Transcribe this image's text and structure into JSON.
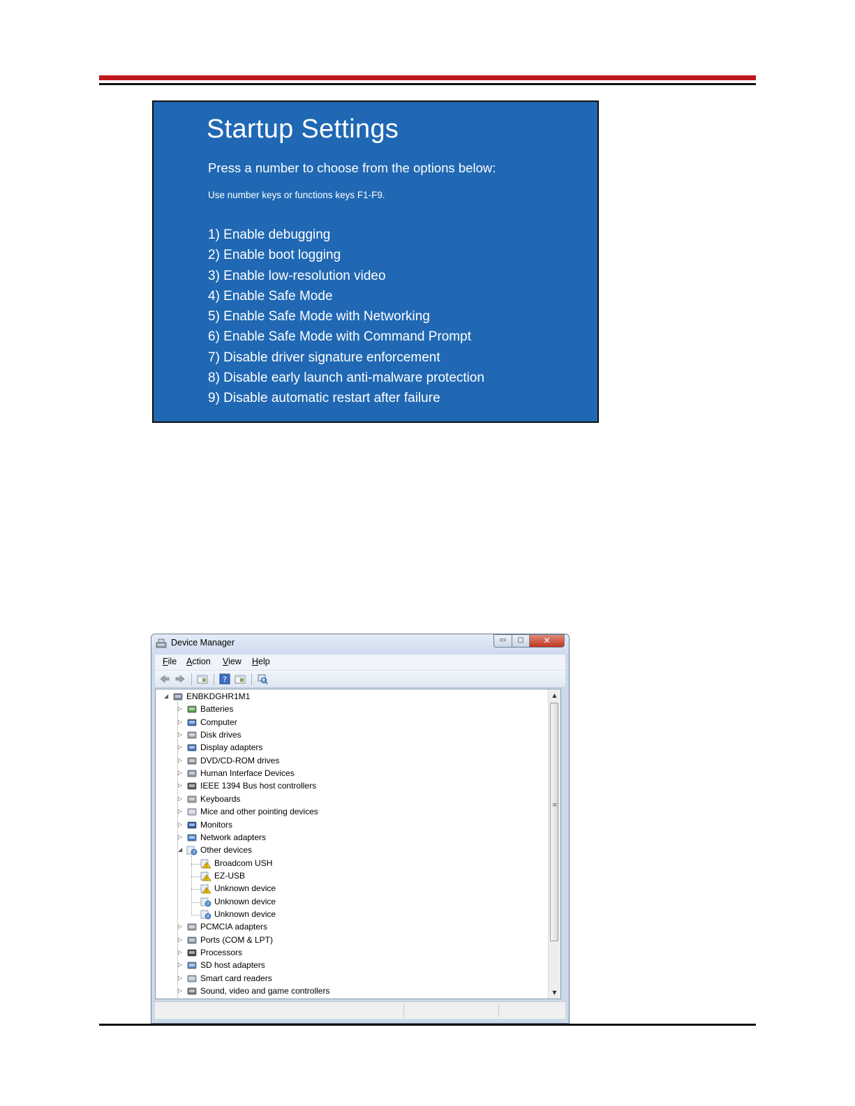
{
  "startup_settings": {
    "title": "Startup Settings",
    "prompt": "Press a number to choose from the options below:",
    "hint": "Use number keys or functions keys F1-F9.",
    "options": [
      "1) Enable debugging",
      "2) Enable boot logging",
      "3) Enable low-resolution video",
      "4) Enable Safe Mode",
      "5) Enable Safe Mode with Networking",
      "6) Enable Safe Mode with Command Prompt",
      "7) Disable driver signature enforcement",
      "8) Disable early launch anti-malware protection",
      "9) Disable automatic restart after failure"
    ]
  },
  "device_manager": {
    "window_title": "Device Manager",
    "window_controls": {
      "minimize": "▭",
      "maximize": "▢",
      "close": "✕"
    },
    "menu": [
      {
        "label": "File",
        "accel": "F",
        "rest": "ile"
      },
      {
        "label": "Action",
        "accel": "A",
        "rest": "ction"
      },
      {
        "label": "View",
        "accel": "V",
        "rest": "iew"
      },
      {
        "label": "Help",
        "accel": "H",
        "rest": "elp"
      }
    ],
    "toolbar_icons": [
      "back-arrow-icon",
      "forward-arrow-icon",
      "show-hide-console-tree-icon",
      "help-icon",
      "properties-icon",
      "scan-hardware-icon"
    ],
    "root": {
      "label": "ENBKDGHR1M1",
      "icon": "computer-network-icon",
      "expanded": true
    },
    "categories": [
      {
        "label": "Batteries",
        "icon": "battery-icon",
        "expanded": false
      },
      {
        "label": "Computer",
        "icon": "computer-icon",
        "expanded": false
      },
      {
        "label": "Disk drives",
        "icon": "disk-drive-icon",
        "expanded": false
      },
      {
        "label": "Display adapters",
        "icon": "display-adapter-icon",
        "expanded": false
      },
      {
        "label": "DVD/CD-ROM drives",
        "icon": "dvd-drive-icon",
        "expanded": false
      },
      {
        "label": "Human Interface Devices",
        "icon": "hid-icon",
        "expanded": false
      },
      {
        "label": "IEEE 1394 Bus host controllers",
        "icon": "firewire-icon",
        "expanded": false
      },
      {
        "label": "Keyboards",
        "icon": "keyboard-icon",
        "expanded": false
      },
      {
        "label": "Mice and other pointing devices",
        "icon": "mouse-icon",
        "expanded": false
      },
      {
        "label": "Monitors",
        "icon": "monitor-icon",
        "expanded": false
      },
      {
        "label": "Network adapters",
        "icon": "network-adapter-icon",
        "expanded": false
      },
      {
        "label": "Other devices",
        "icon": "unknown-device-icon",
        "expanded": true,
        "children": [
          {
            "label": "Broadcom USH",
            "icon": "warning-device-icon"
          },
          {
            "label": "EZ-USB",
            "icon": "warning-device-icon"
          },
          {
            "label": "Unknown device",
            "icon": "warning-device-icon"
          },
          {
            "label": "Unknown device",
            "icon": "unknown-device-icon"
          },
          {
            "label": "Unknown device",
            "icon": "unknown-device-icon"
          }
        ]
      },
      {
        "label": "PCMCIA adapters",
        "icon": "pcmcia-icon",
        "expanded": false
      },
      {
        "label": "Ports (COM & LPT)",
        "icon": "port-icon",
        "expanded": false
      },
      {
        "label": "Processors",
        "icon": "processor-icon",
        "expanded": false
      },
      {
        "label": "SD host adapters",
        "icon": "sd-host-icon",
        "expanded": false
      },
      {
        "label": "Smart card readers",
        "icon": "smart-card-icon",
        "expanded": false
      },
      {
        "label": "Sound, video and game controllers",
        "icon": "speaker-icon",
        "expanded": false
      }
    ],
    "colors": {
      "startup_background": "#2068b3",
      "header_rule": "#c0161d"
    }
  }
}
